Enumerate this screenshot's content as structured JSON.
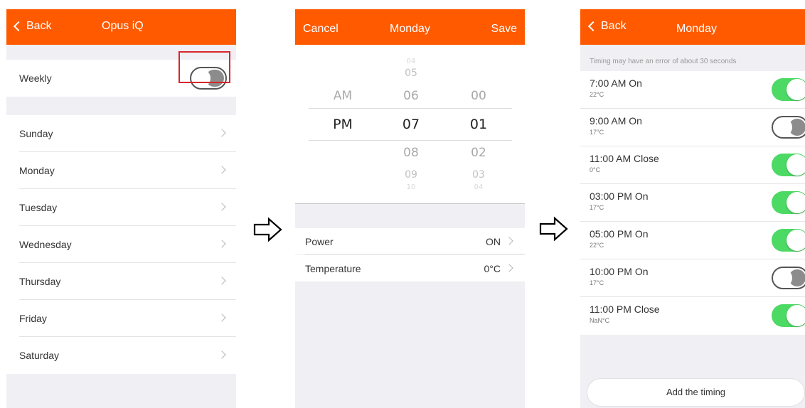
{
  "screen1": {
    "back_label": "Back",
    "title": "Opus iQ",
    "weekly_label": "Weekly",
    "weekly_on": false,
    "days": [
      "Sunday",
      "Monday",
      "Tuesday",
      "Wednesday",
      "Thursday",
      "Friday",
      "Saturday"
    ]
  },
  "screen2": {
    "cancel_label": "Cancel",
    "title": "Monday",
    "save_label": "Save",
    "picker": {
      "ampm_options": [
        "AM",
        "PM"
      ],
      "ampm_selected": "PM",
      "hour_options": [
        "04",
        "05",
        "06",
        "07",
        "08",
        "09",
        "10"
      ],
      "hour_selected": "07",
      "minute_options": [
        "00",
        "01",
        "02",
        "03",
        "04"
      ],
      "minute_selected": "01"
    },
    "power_label": "Power",
    "power_value": "ON",
    "temperature_label": "Temperature",
    "temperature_value": "0°C"
  },
  "screen3": {
    "back_label": "Back",
    "title": "Monday",
    "note": "Timing may have an error of about 30 seconds",
    "timings": [
      {
        "title": "7:00 AM On",
        "temp": "22°C",
        "enabled": true
      },
      {
        "title": "9:00 AM On",
        "temp": "17°C",
        "enabled": false
      },
      {
        "title": "11:00 AM Close",
        "temp": "0°C",
        "enabled": true
      },
      {
        "title": "03:00 PM On",
        "temp": "17°C",
        "enabled": true
      },
      {
        "title": "05:00 PM On",
        "temp": "22°C",
        "enabled": true
      },
      {
        "title": "10:00 PM On",
        "temp": "17°C",
        "enabled": false
      },
      {
        "title": "11:00 PM Close",
        "temp": "NaN°C",
        "enabled": true
      }
    ],
    "add_label": "Add the timing"
  },
  "colors": {
    "brand": "#ff5a00",
    "toggle_on": "#4cd964",
    "highlight": "#d8262d"
  }
}
